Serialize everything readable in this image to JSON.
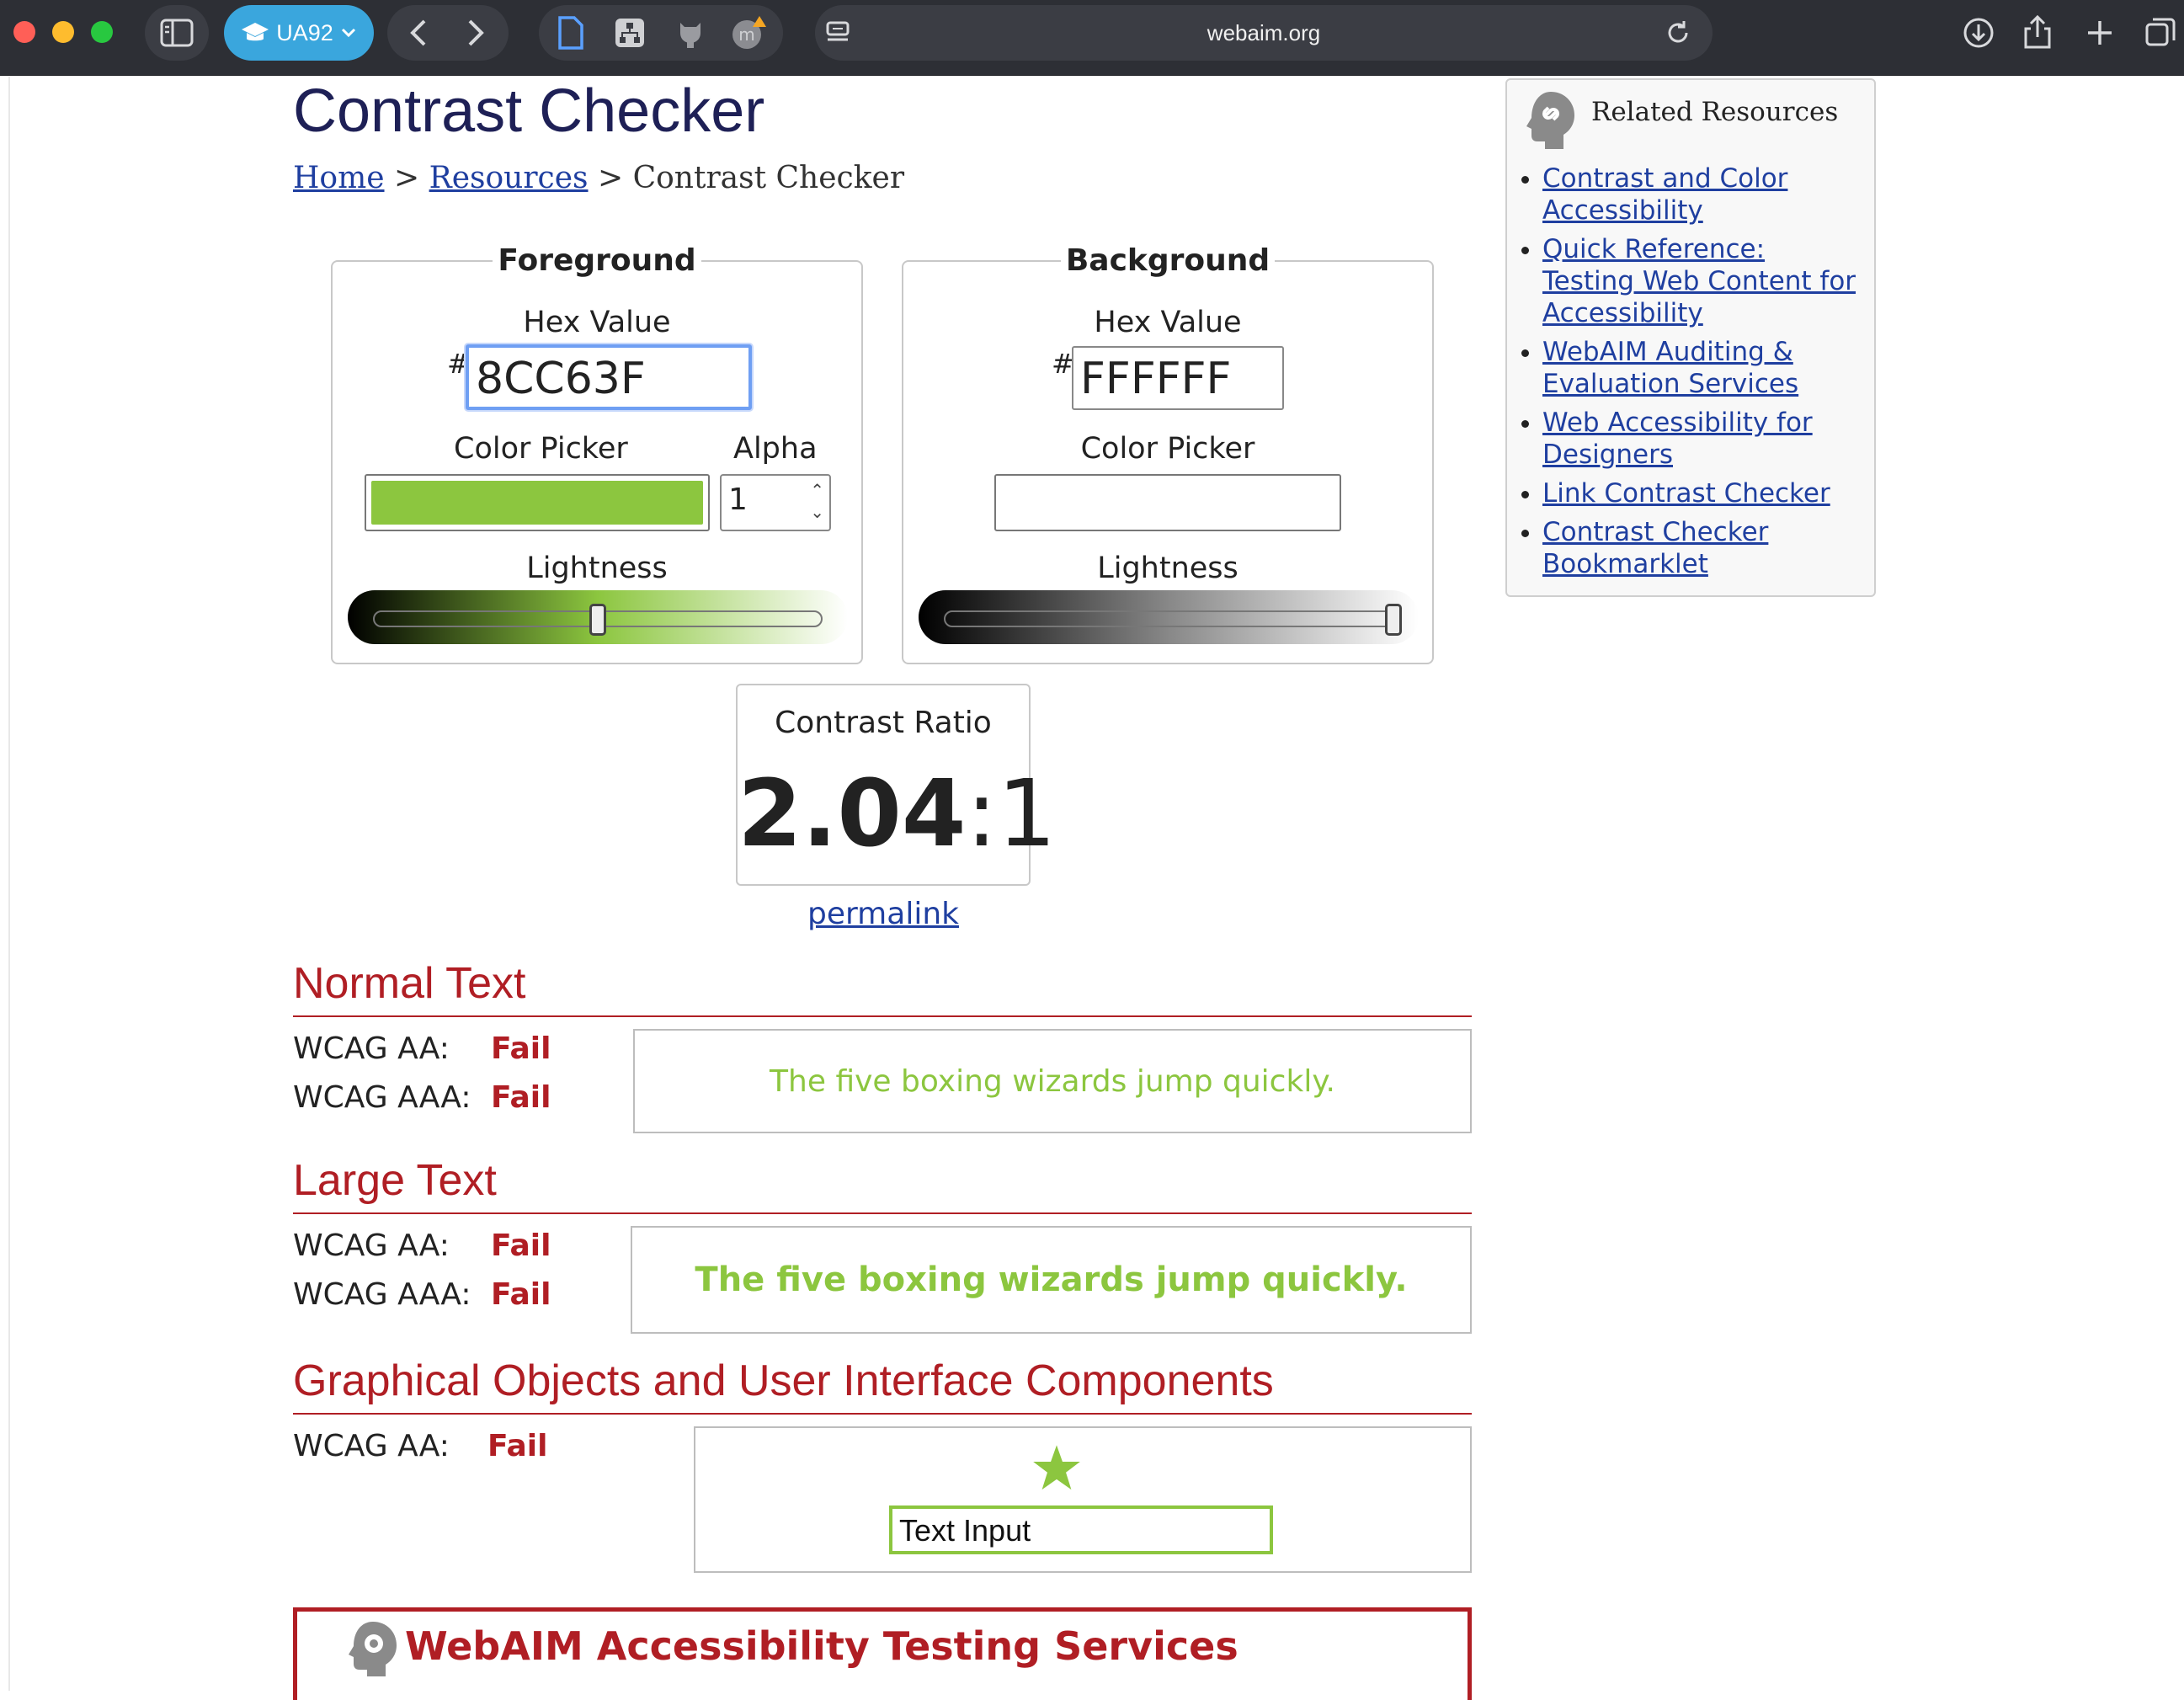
{
  "browser": {
    "profile_label": "UA92",
    "address": "webaim.org"
  },
  "page": {
    "title": "Contrast Checker",
    "breadcrumb": {
      "home": "Home",
      "sep1": ">",
      "resources": "Resources",
      "sep2": ">",
      "current": "Contrast Checker"
    }
  },
  "foreground": {
    "legend": "Foreground",
    "hex_label": "Hex Value",
    "hash": "#",
    "hex_value": "8CC63F",
    "picker_label": "Color Picker",
    "alpha_label": "Alpha",
    "alpha_value": "1",
    "lightness_label": "Lightness",
    "lightness_level": 0.5,
    "color": "#8CC63F"
  },
  "background": {
    "legend": "Background",
    "hex_label": "Hex Value",
    "hash": "#",
    "hex_value": "FFFFFF",
    "picker_label": "Color Picker",
    "lightness_label": "Lightness",
    "lightness_level": 1.0,
    "color": "#FFFFFF"
  },
  "contrast": {
    "label": "Contrast Ratio",
    "ratio_main": "2.04",
    "ratio_suffix": ":1",
    "permalink": "permalink"
  },
  "results": {
    "normal": {
      "heading": "Normal Text",
      "aa_label": "WCAG AA:",
      "aa_result": "Fail",
      "aaa_label": "WCAG AAA:",
      "aaa_result": "Fail",
      "sample": "The five boxing wizards jump quickly."
    },
    "large": {
      "heading": "Large Text",
      "aa_label": "WCAG AA:",
      "aa_result": "Fail",
      "aaa_label": "WCAG AAA:",
      "aaa_result": "Fail",
      "sample": "The five boxing wizards jump quickly."
    },
    "graphical": {
      "heading": "Graphical Objects and User Interface Components",
      "aa_label": "WCAG AA:",
      "aa_result": "Fail",
      "input_text": "Text Input"
    }
  },
  "services": {
    "title": "WebAIM Accessibility Testing Services"
  },
  "sidebar": {
    "title": "Related Resources",
    "links": [
      "Contrast and Color Accessibility",
      "Quick Reference: Testing Web Content for Accessibility",
      "WebAIM Auditing & Evaluation Services",
      "Web Accessibility for Designers",
      "Link Contrast Checker",
      "Contrast Checker Bookmarklet"
    ]
  },
  "colors": {
    "fail_red": "#b01e24",
    "title_navy": "#1e2056",
    "link_blue": "#1f3fa0",
    "sample_green": "#8CC63F"
  }
}
